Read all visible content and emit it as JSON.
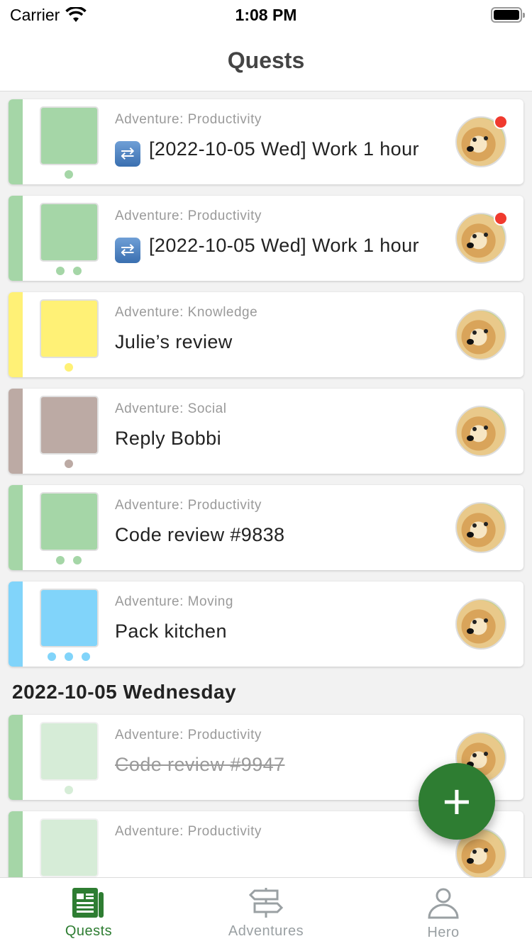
{
  "status_bar": {
    "carrier": "Carrier",
    "time": "1:08 PM"
  },
  "header": {
    "title": "Quests"
  },
  "quests": [
    {
      "adventure": "Adventure: Productivity",
      "title": "[2022-10-05 Wed] Work 1 hour",
      "repeat": true,
      "color": "#a5d6a7",
      "dots": 1,
      "badge": true,
      "done": false
    },
    {
      "adventure": "Adventure: Productivity",
      "title": "[2022-10-05 Wed] Work 1 hour",
      "repeat": true,
      "color": "#a5d6a7",
      "dots": 2,
      "badge": true,
      "done": false
    },
    {
      "adventure": "Adventure: Knowledge",
      "title": "Julie’s review",
      "repeat": false,
      "color": "#fff176",
      "dots": 1,
      "badge": false,
      "done": false
    },
    {
      "adventure": "Adventure: Social",
      "title": "Reply Bobbi",
      "repeat": false,
      "color": "#bcaaa4",
      "dots": 1,
      "badge": false,
      "done": false
    },
    {
      "adventure": "Adventure: Productivity",
      "title": "Code review #9838",
      "repeat": false,
      "color": "#a5d6a7",
      "dots": 2,
      "badge": false,
      "done": false
    },
    {
      "adventure": "Adventure: Moving",
      "title": "Pack kitchen",
      "repeat": false,
      "color": "#81d4fa",
      "dots": 3,
      "badge": false,
      "done": false
    }
  ],
  "section": {
    "title": "2022-10-05 Wednesday"
  },
  "done_quests": [
    {
      "adventure": "Adventure: Productivity",
      "title": "Code review #9947",
      "color": "#a5d6a7",
      "dots": 1,
      "done": true
    },
    {
      "adventure": "Adventure: Productivity",
      "title": "",
      "color": "#a5d6a7",
      "dots": 1,
      "done": true
    }
  ],
  "fab": {
    "label": "+"
  },
  "tabs": [
    {
      "label": "Quests",
      "icon": "newspaper-icon",
      "active": true
    },
    {
      "label": "Adventures",
      "icon": "signpost-icon",
      "active": false
    },
    {
      "label": "Hero",
      "icon": "person-icon",
      "active": false
    }
  ],
  "colors": {
    "accent": "#2e7d32",
    "inactive": "#9aa0a3",
    "badge": "#f03a2e"
  }
}
